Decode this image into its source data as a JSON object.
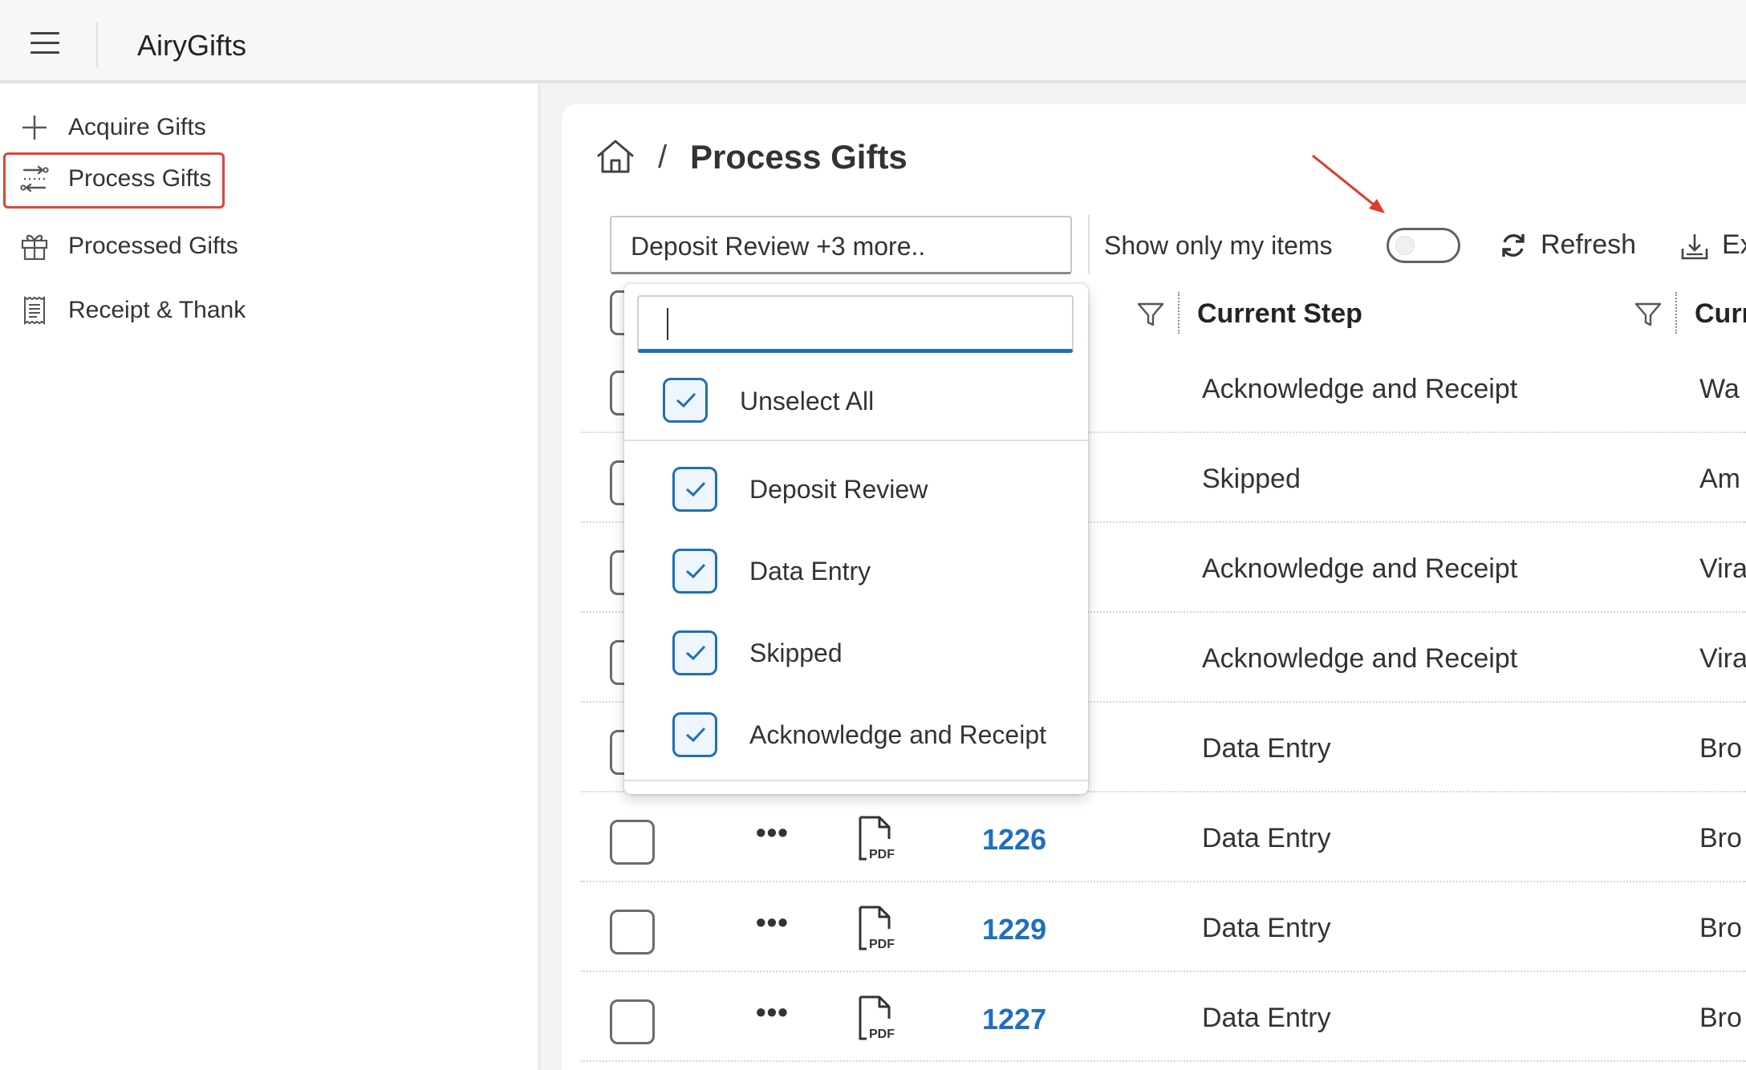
{
  "app": {
    "title": "AiryGifts"
  },
  "sidebar": {
    "items": [
      {
        "label": "Acquire Gifts",
        "icon": "plus-icon",
        "active": false
      },
      {
        "label": "Process Gifts",
        "icon": "process-flow-icon",
        "active": true
      },
      {
        "label": "Processed Gifts",
        "icon": "gift-icon",
        "active": false
      },
      {
        "label": "Receipt & Thank",
        "icon": "receipt-icon",
        "active": false
      }
    ]
  },
  "breadcrumb": {
    "separator": "/",
    "title": "Process Gifts"
  },
  "toolbar": {
    "filter_value": "Deposit Review   +3 more..",
    "show_mine_label": "Show only my items",
    "show_mine_on": false,
    "refresh_label": "Refresh",
    "export_label_visible": "Ex"
  },
  "table": {
    "headers": {
      "current_step": "Current Step",
      "next_col_partial": "Curr"
    },
    "rows": [
      {
        "id": "",
        "step": "Acknowledge and Receipt",
        "user": "Wa"
      },
      {
        "id": "",
        "step": "Skipped",
        "user": "Am"
      },
      {
        "id": "",
        "step": "Acknowledge and Receipt",
        "user": "Vira"
      },
      {
        "id": "",
        "step": "Acknowledge and Receipt",
        "user": "Vira"
      },
      {
        "id": "",
        "step": "Data Entry",
        "user": "Bro"
      },
      {
        "id": "1226",
        "step": "Data Entry",
        "user": "Bro"
      },
      {
        "id": "1229",
        "step": "Data Entry",
        "user": "Bro"
      },
      {
        "id": "1227",
        "step": "Data Entry",
        "user": "Bro"
      }
    ],
    "more_glyph": "•••"
  },
  "dropdown": {
    "search_value": "",
    "unselect_all": "Unselect All",
    "options": [
      {
        "label": "Deposit Review",
        "checked": true
      },
      {
        "label": "Data Entry",
        "checked": true
      },
      {
        "label": "Skipped",
        "checked": true
      },
      {
        "label": "Acknowledge and Receipt",
        "checked": true
      }
    ]
  },
  "colors": {
    "accent": "#1f6fb5",
    "link": "#1f6fc1",
    "active_outline": "#d9463b",
    "annotation_arrow": "#e0392f"
  }
}
